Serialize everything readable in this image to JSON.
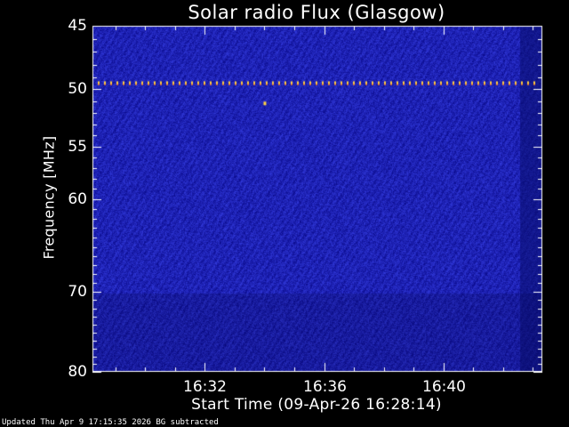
{
  "chart_data": {
    "type": "heatmap",
    "title": "Solar radio Flux (Glasgow)",
    "xlabel": "Start Time (09-Apr-26 16:28:14)",
    "ylabel": "Frequency [MHz]",
    "x_tick_labels": [
      "16:32",
      "16:36",
      "16:40"
    ],
    "y_tick_labels": [
      "45",
      "50",
      "55",
      "60",
      "70",
      "80"
    ],
    "y_ticks": [
      45,
      50,
      55,
      60,
      70,
      80
    ],
    "ylim": [
      45,
      80
    ],
    "y_scale": "log",
    "x_start": "16:28:14",
    "x_end": "16:43:19",
    "colors": {
      "background": "#1e22b4",
      "interference": "#ffd040",
      "axes": "#ffffff"
    },
    "features": {
      "interference_line_mhz": 49.5,
      "spot_mhz": 51.2,
      "spot_time": "16:34:00"
    }
  },
  "footer": "Updated Thu Apr  9 17:15:35 2026   BG subtracted"
}
